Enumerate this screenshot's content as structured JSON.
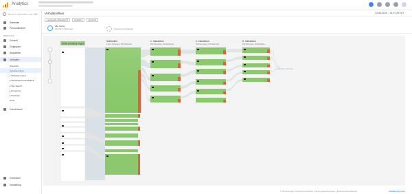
{
  "app": {
    "title": "Analytics"
  },
  "topbar": {
    "icons": [
      "notifications-icon",
      "apps-icon",
      "help-icon",
      "more-icon",
      "avatar"
    ]
  },
  "sidebar": {
    "search_placeholder": "Suche in Berichten und Hilfe",
    "items": [
      {
        "label": "Startseite",
        "icon": "home-icon"
      },
      {
        "label": "Personalisieren",
        "icon": "customize-icon"
      }
    ],
    "section_label": "BERICHTE",
    "report_items": [
      {
        "label": "Echtzeit",
        "icon": "clock-icon"
      },
      {
        "label": "Zielgruppe",
        "icon": "person-icon"
      },
      {
        "label": "Akquisition",
        "icon": "acquisition-icon"
      },
      {
        "label": "Verhalten",
        "icon": "behavior-icon",
        "active": true
      }
    ],
    "sub_items": [
      {
        "label": "Übersicht"
      },
      {
        "label": "Verhaltensfluss",
        "active": true
      },
      {
        "label": "▸ Websitecontent"
      },
      {
        "label": "▸ Websitegeschwindigkeit"
      },
      {
        "label": "▸ Site Search"
      },
      {
        "label": "▸ Ereignisse"
      },
      {
        "label": "▸ Publisher"
      },
      {
        "label": "Tests"
      }
    ],
    "conversions": {
      "label": "Conversions",
      "icon": "flag-icon"
    },
    "bottom_items": [
      {
        "label": "Entdecken",
        "icon": "lightbulb-icon"
      },
      {
        "label": "Verwaltung",
        "icon": "gear-icon"
      }
    ]
  },
  "header": {
    "title": "Verhaltensfluss",
    "date_range": "14.06.2019 - 14.07.2019 ▾"
  },
  "controls": [
    "Landeseite (Zielseite) ▾",
    "Ansicht ▾",
    "Export ▾"
  ],
  "segment": {
    "name": "Alle Nutzer",
    "sub": "100,00 % Sitzungen",
    "add_label": "+ Segment hinzufügen"
  },
  "flow": {
    "columns": [
      {
        "title": "Seite (Landing Page)",
        "sub": ""
      },
      {
        "title": "Startseiten",
        "sub": "1 Mio. Sitzungen, 500 Abbrüche"
      },
      {
        "title": "1. Interaktion",
        "sub": "500 Sitzungen, 200 Abbrüche"
      },
      {
        "title": "2. Interaktion",
        "sub": "300 Sitzungen, 150 Abbrüche"
      },
      {
        "title": "3. Interaktion",
        "sub": "150 Sitzungen, 60 Abbrüche"
      }
    ],
    "more_label": "+ Weitere Schritte"
  },
  "footer": {
    "copyright": "© 2019 Google | Analytics-Startseite | Nutzungsbedingungen | Datenschutzerklärung",
    "feedback": "Feedback senden"
  }
}
